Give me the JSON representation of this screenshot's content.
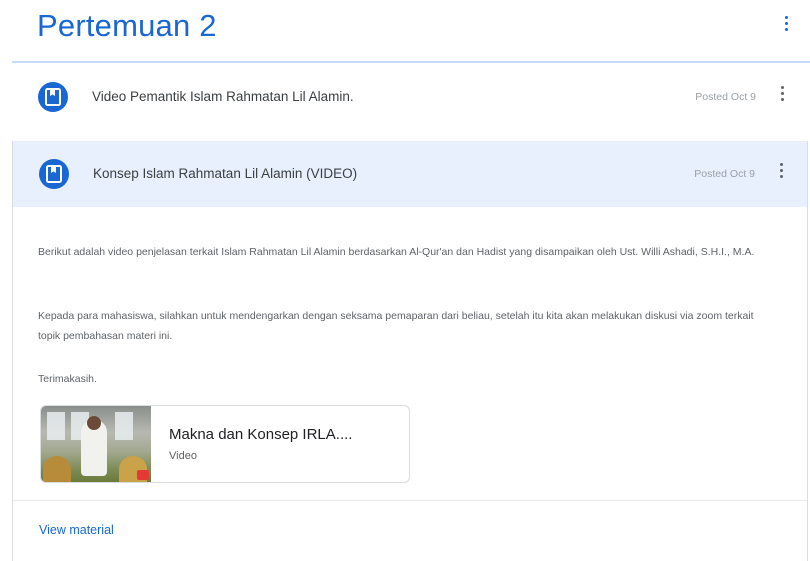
{
  "topic": {
    "title": "Pertemuan 2"
  },
  "items": [
    {
      "title": "Video Pemantik Islam Rahmatan Lil Alamin.",
      "posted": "Posted Oct 9"
    },
    {
      "title": "Konsep Islam Rahmatan Lil Alamin (VIDEO)",
      "posted": "Posted Oct 9"
    }
  ],
  "expanded": {
    "paragraphs": [
      "Berikut adalah video penjelasan terkait Islam Rahmatan Lil Alamin berdasarkan Al-Qur'an dan Hadist yang disampaikan oleh Ust. Willi Ashadi, S.H.I., M.A.",
      "Kepada para mahasiswa, silahkan untuk mendengarkan dengan seksama pemaparan dari beliau, setelah itu kita akan melakukan diskusi via zoom terkait topik pembahasan materi ini.",
      "Terimakasih."
    ],
    "attachment": {
      "title": "Makna dan Konsep IRLA....",
      "type": "Video"
    },
    "view_link": "View material"
  },
  "colors": {
    "accent": "#1967d2",
    "highlight": "#e8f0fe"
  },
  "icons": [
    "material-icon",
    "more-vert-icon"
  ]
}
